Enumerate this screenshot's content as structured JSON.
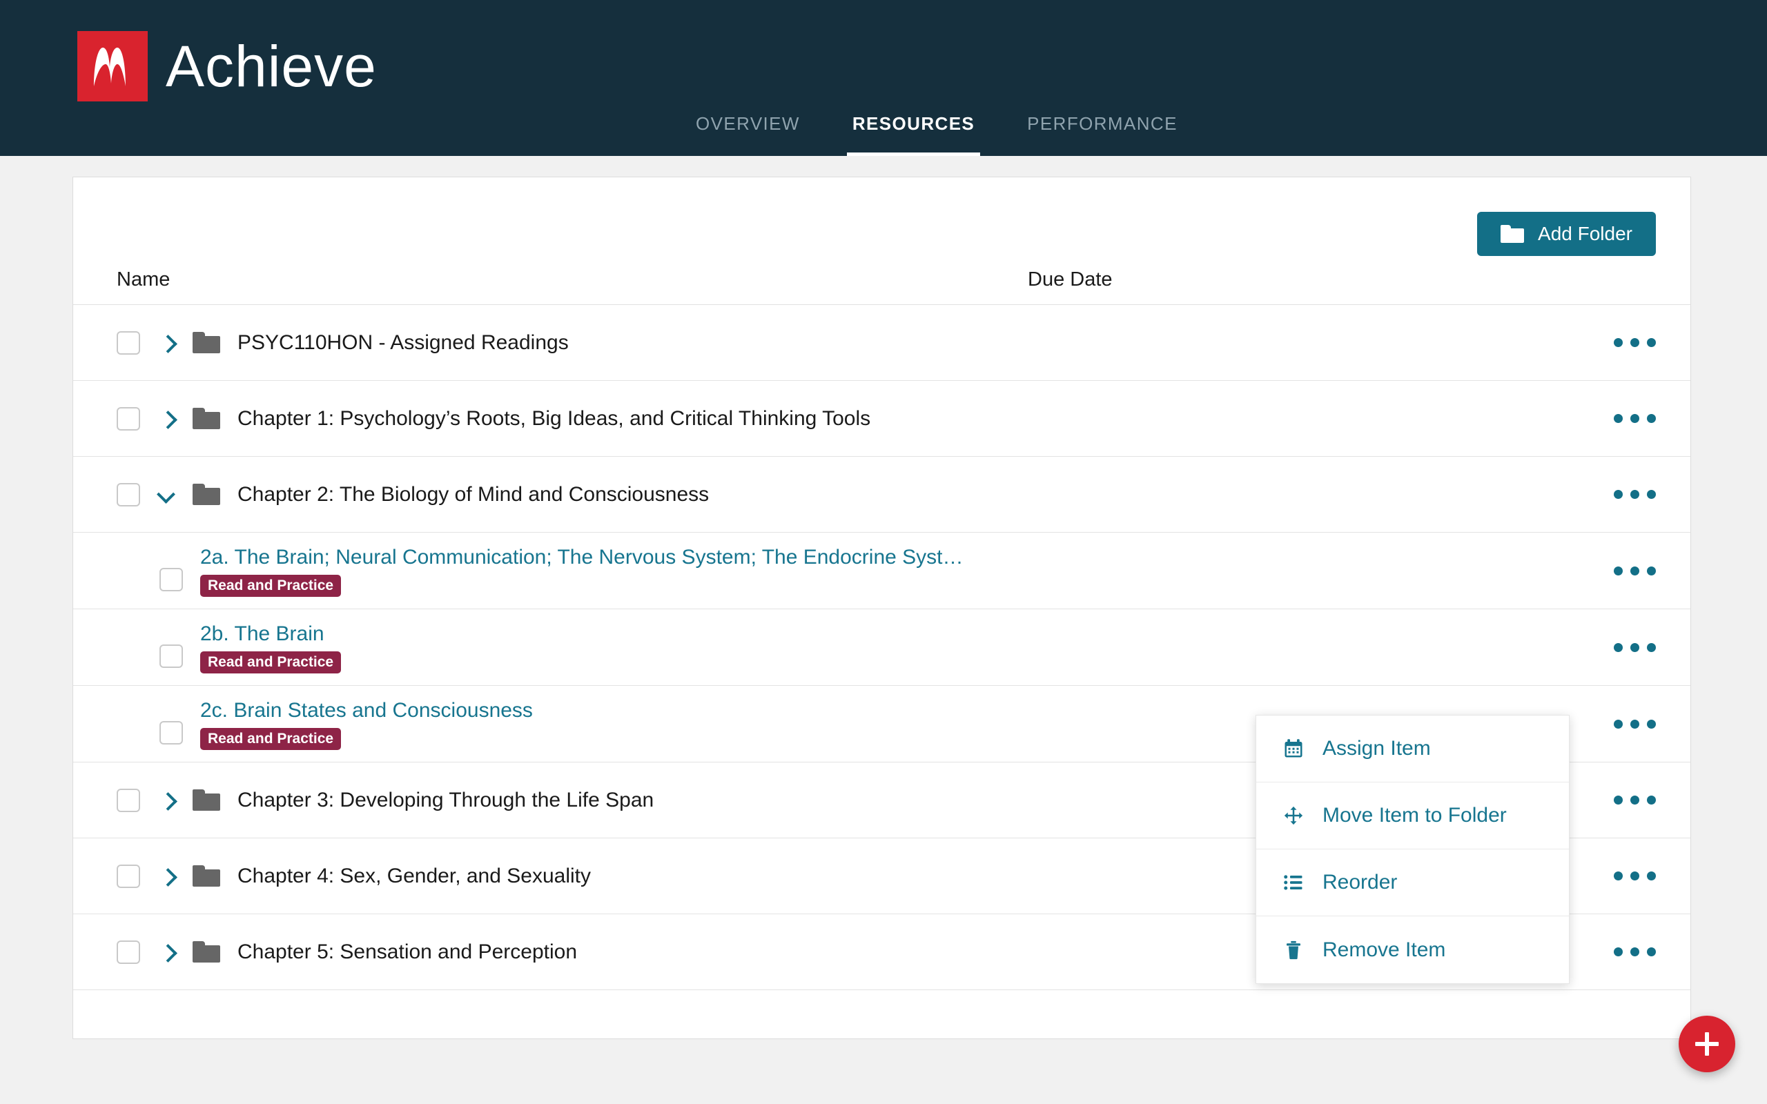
{
  "header": {
    "brand": {
      "name": "Achieve",
      "mark_letter": "M",
      "mark_color": "#d9232e",
      "bar_color": "#152f3d"
    },
    "nav": [
      {
        "label": "OVERVIEW",
        "active": false
      },
      {
        "label": "RESOURCES",
        "active": true
      },
      {
        "label": "PERFORMANCE",
        "active": false
      }
    ]
  },
  "toolbar": {
    "add_folder_label": "Add Folder",
    "add_folder_icon": "folder-icon",
    "accent_color": "#136f87"
  },
  "table": {
    "columns": {
      "name": "Name",
      "due_date": "Due Date"
    },
    "rows": [
      {
        "type": "folder",
        "title": "PSYC110HON - Assigned Readings",
        "expanded": false
      },
      {
        "type": "folder",
        "title": "Chapter 1: Psychology’s Roots, Big Ideas, and Critical Thinking Tools",
        "expanded": false
      },
      {
        "type": "folder",
        "title": "Chapter 2: The Biology of Mind and Consciousness",
        "expanded": true
      },
      {
        "type": "item",
        "title": "2a. The Brain; Neural Communication; The Nervous System; The Endocrine Syst…",
        "badge": "Read and Practice"
      },
      {
        "type": "item",
        "title": "2b. The Brain",
        "badge": "Read and Practice"
      },
      {
        "type": "item",
        "title": "2c. Brain States and Consciousness",
        "badge": "Read and Practice"
      },
      {
        "type": "folder",
        "title": "Chapter 3: Developing Through the Life Span",
        "expanded": false
      },
      {
        "type": "folder",
        "title": "Chapter 4: Sex, Gender, and Sexuality",
        "expanded": false
      },
      {
        "type": "folder",
        "title": "Chapter 5: Sensation and Perception",
        "expanded": false
      }
    ]
  },
  "context_menu": {
    "items": [
      {
        "label": "Assign Item",
        "icon": "calendar-icon"
      },
      {
        "label": "Move Item to Folder",
        "icon": "move-arrows-icon"
      },
      {
        "label": "Reorder",
        "icon": "list-icon"
      },
      {
        "label": "Remove Item",
        "icon": "trash-icon"
      }
    ]
  },
  "fab": {
    "icon": "plus-icon",
    "color": "#d8232f"
  },
  "colors": {
    "header_bg": "#152f3d",
    "teal": "#136f87",
    "link_teal": "#17758f",
    "badge_maroon": "#8e2447",
    "page_bg": "#f1f1f1",
    "folder_gray": "#666666"
  }
}
